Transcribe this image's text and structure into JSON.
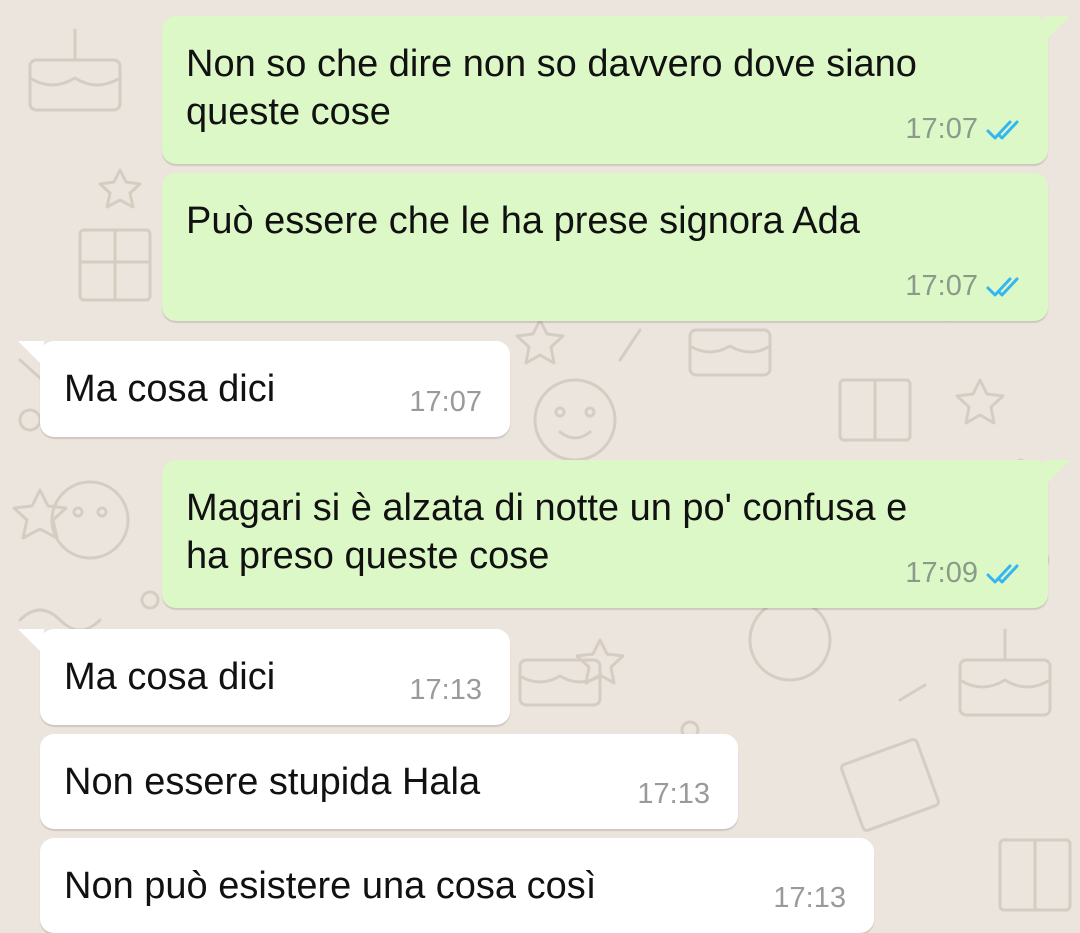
{
  "colors": {
    "outgoing_bubble": "#dcf8c6",
    "incoming_bubble": "#ffffff",
    "wallpaper": "#ece5dd",
    "read_ticks": "#34b7f1"
  },
  "icons": {
    "read_receipt": "double-check-icon"
  },
  "messages": [
    {
      "direction": "out",
      "text": "Non so che dire non so davvero dove siano\nqueste cose",
      "time": "17:07",
      "status": "read"
    },
    {
      "direction": "out",
      "text": "Può essere che le ha prese signora Ada",
      "time": "17:07",
      "status": "read"
    },
    {
      "direction": "in",
      "text": "Ma cosa dici",
      "time": "17:07"
    },
    {
      "direction": "out",
      "text": "Magari si è alzata di notte un po' confusa e\nha preso queste cose",
      "time": "17:09",
      "status": "read"
    },
    {
      "direction": "in",
      "text": "Ma cosa dici",
      "time": "17:13"
    },
    {
      "direction": "in",
      "text": "Non essere stupida Hala",
      "time": "17:13"
    },
    {
      "direction": "in",
      "text": "Non può esistere una cosa così",
      "time": "17:13"
    }
  ]
}
